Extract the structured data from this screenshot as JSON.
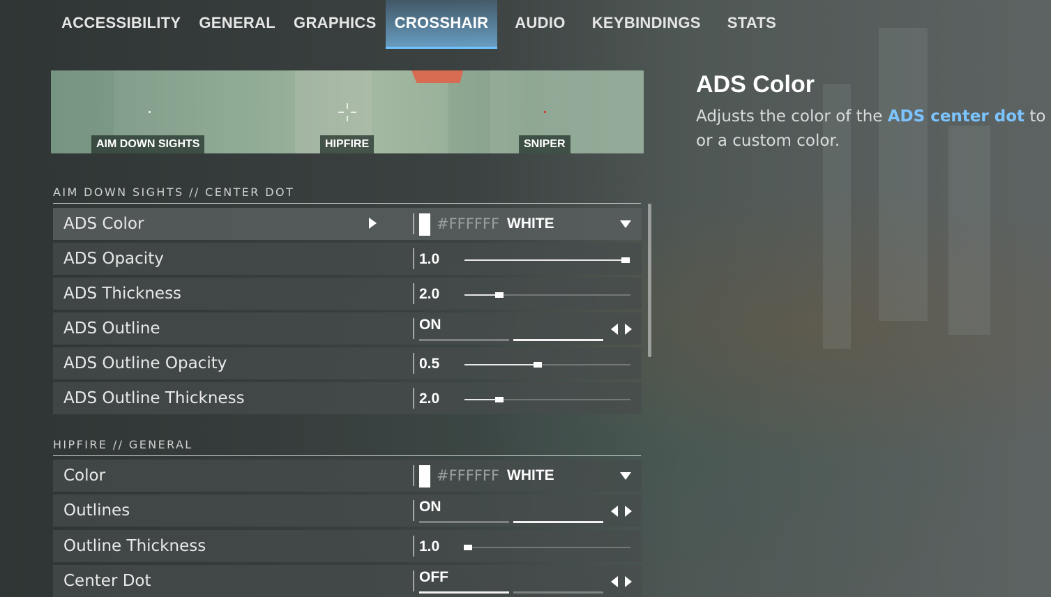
{
  "tabs": [
    {
      "label": "ACCESSIBILITY"
    },
    {
      "label": "GENERAL"
    },
    {
      "label": "GRAPHICS"
    },
    {
      "label": "CROSSHAIR",
      "active": true
    },
    {
      "label": "AUDIO"
    },
    {
      "label": "KEYBINDINGS"
    },
    {
      "label": "STATS"
    }
  ],
  "preview": {
    "labels": [
      "AIM DOWN SIGHTS",
      "HIPFIRE",
      "SNIPER"
    ],
    "sniper_dot_color": "#e02020"
  },
  "sections": {
    "ads": {
      "title": "AIM DOWN SIGHTS // CENTER DOT",
      "rows": {
        "color": {
          "label": "ADS Color",
          "swatch": "#FFFFFF",
          "hex": "#FFFFFF",
          "name": "WHITE"
        },
        "opacity": {
          "label": "ADS Opacity",
          "value": "1.0",
          "fraction": 0.97
        },
        "thickness": {
          "label": "ADS Thickness",
          "value": "2.0",
          "fraction": 0.21
        },
        "outline": {
          "label": "ADS Outline",
          "value": "ON"
        },
        "outline_opacity": {
          "label": "ADS Outline Opacity",
          "value": "0.5",
          "fraction": 0.44
        },
        "outline_thickness": {
          "label": "ADS Outline Thickness",
          "value": "2.0",
          "fraction": 0.21
        }
      }
    },
    "hipfire": {
      "title": "HIPFIRE // GENERAL",
      "rows": {
        "color": {
          "label": "Color",
          "swatch": "#FFFFFF",
          "hex": "#FFFFFF",
          "name": "WHITE"
        },
        "outlines": {
          "label": "Outlines",
          "value": "ON"
        },
        "outline_thickness": {
          "label": "Outline Thickness",
          "value": "1.0",
          "fraction": 0.02
        },
        "center_dot": {
          "label": "Center Dot",
          "value": "OFF"
        }
      }
    }
  },
  "description": {
    "title": "ADS Color",
    "text_before": "Adjusts the color of the ",
    "highlight": "ADS center dot",
    "text_after": " to any",
    "line2": "or a custom color.",
    "highlight_color": "#7cc4ff"
  }
}
